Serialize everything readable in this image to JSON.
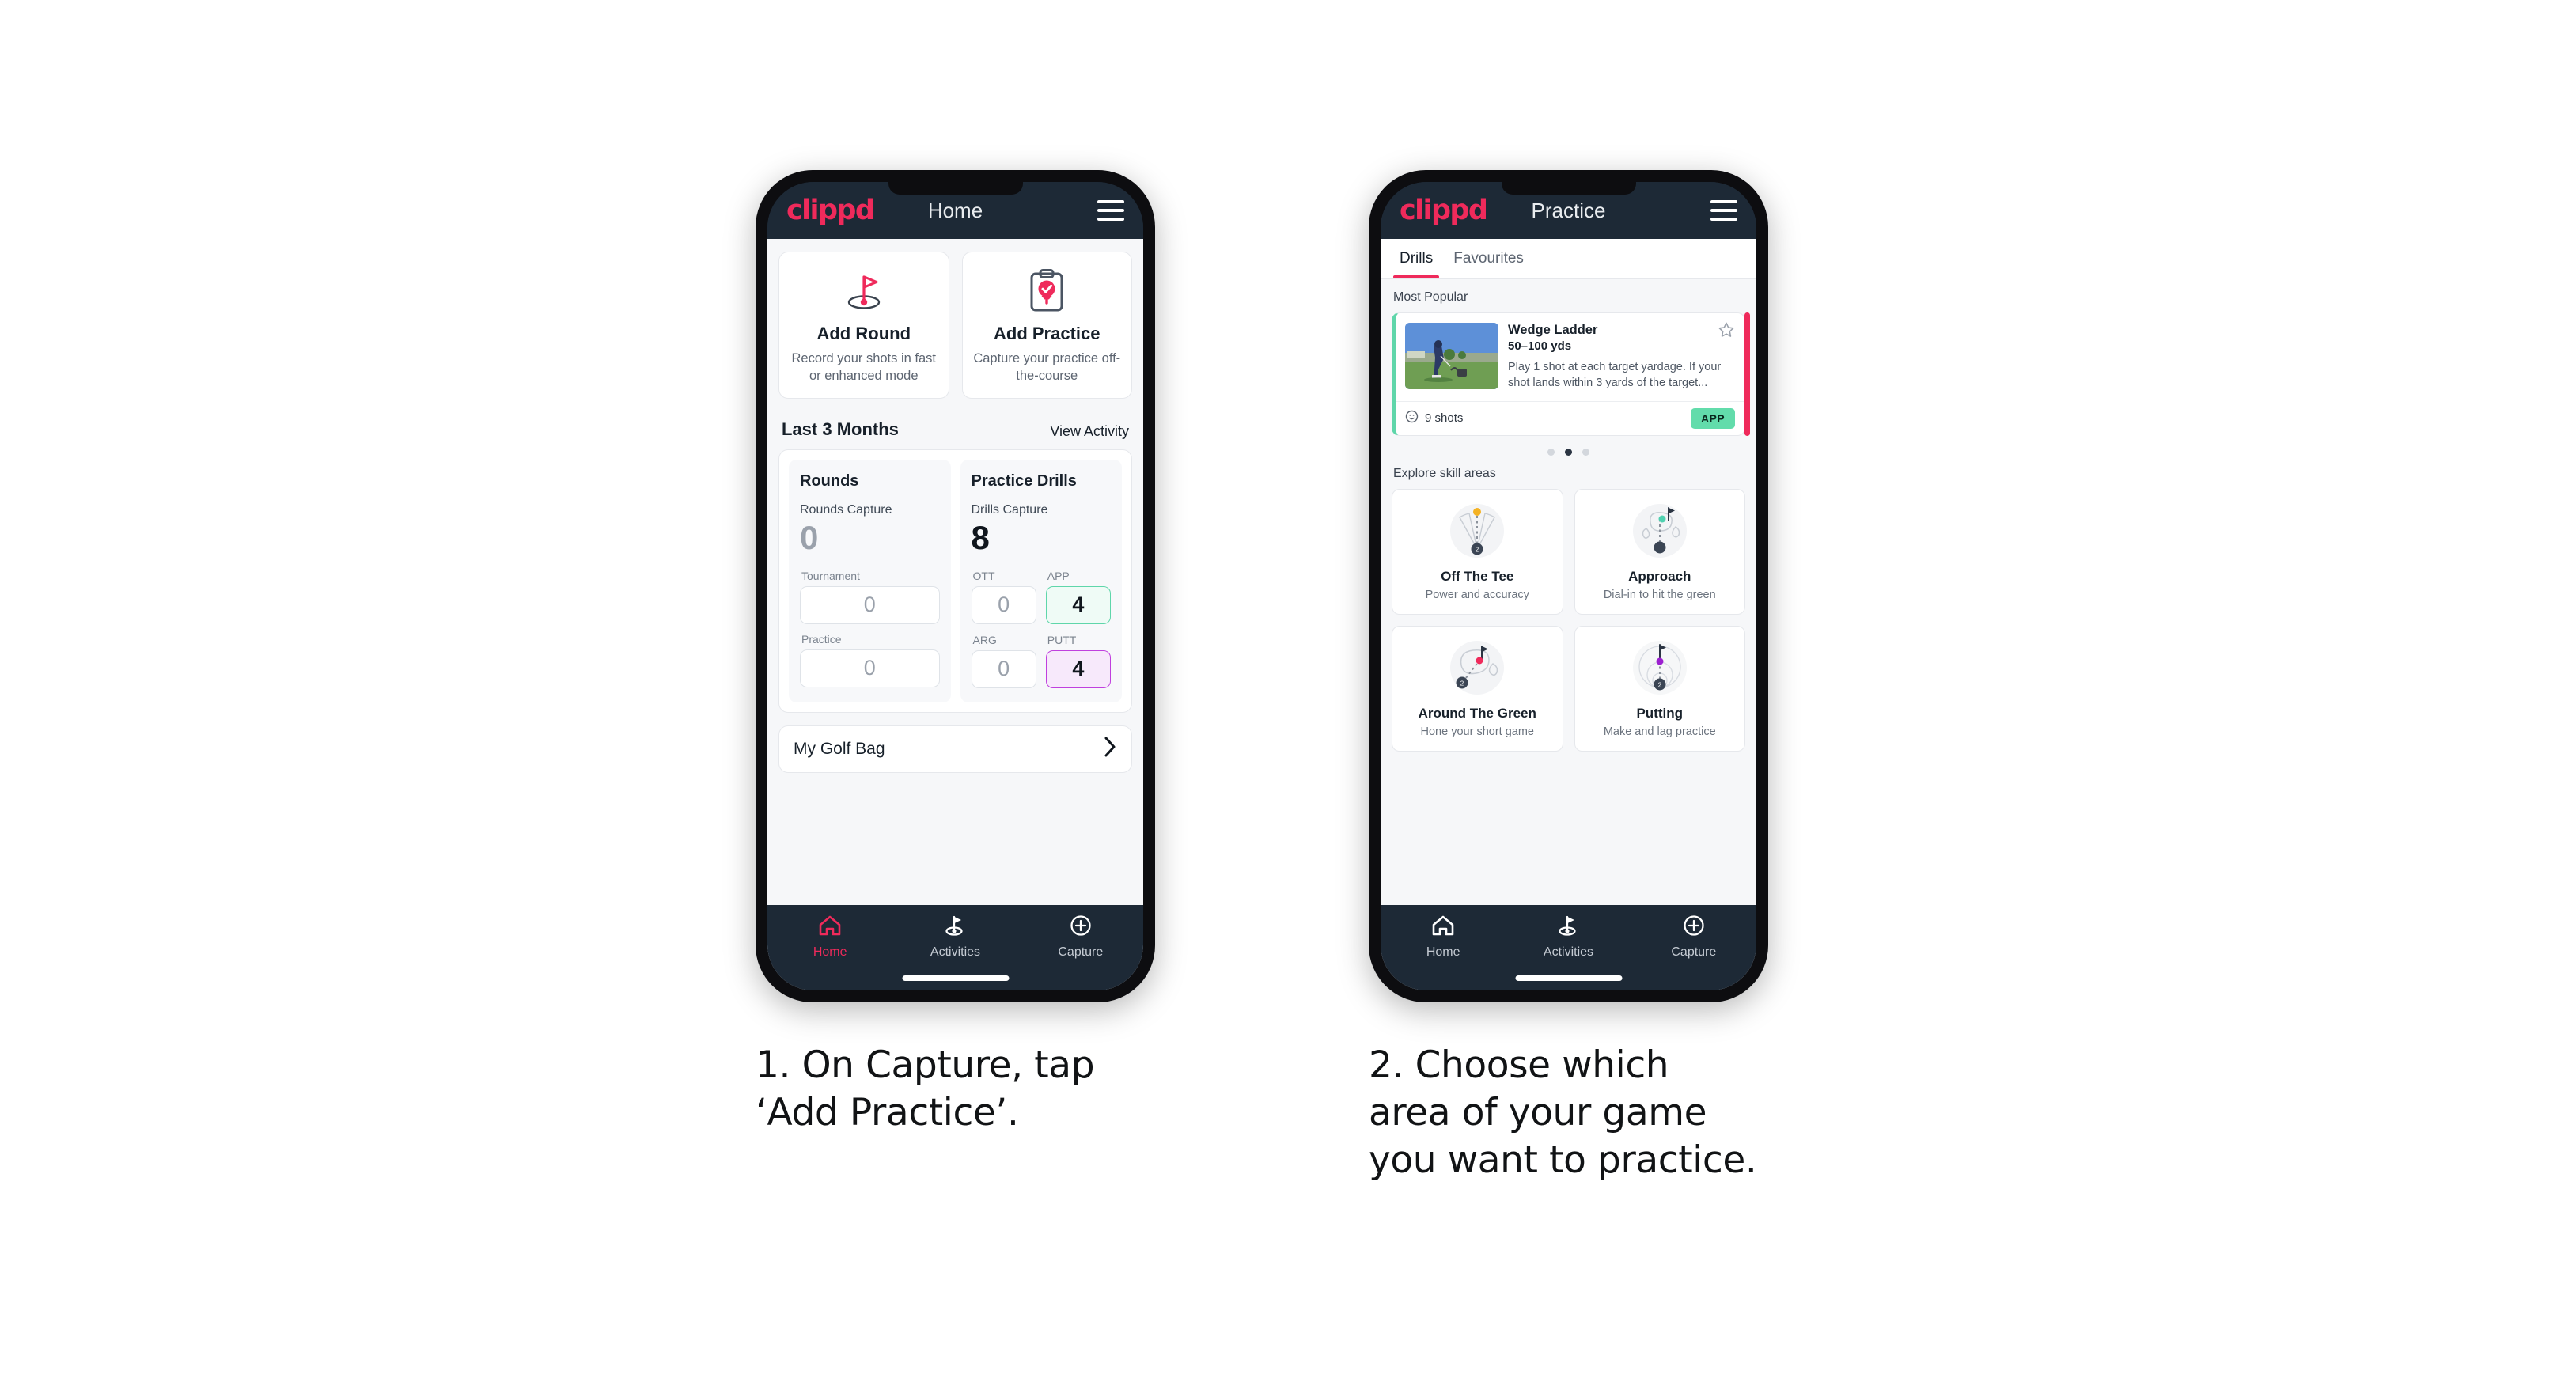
{
  "phone1": {
    "appbar": {
      "logo": "clippd",
      "title": "Home",
      "menu_icon": "hamburger-menu-icon"
    },
    "tiles": [
      {
        "icon": "golf-flag-icon",
        "title": "Add Round",
        "sub": "Record your shots in fast or enhanced mode"
      },
      {
        "icon": "clipboard-check-icon",
        "title": "Add Practice",
        "sub": "Capture your practice off-the-course"
      }
    ],
    "section": {
      "title": "Last 3 Months",
      "link": "View Activity"
    },
    "rounds": {
      "title": "Rounds",
      "capture_label": "Rounds Capture",
      "capture_value": "0",
      "fields": [
        {
          "label": "Tournament",
          "value": "0"
        },
        {
          "label": "Practice",
          "value": "0"
        }
      ]
    },
    "drills": {
      "title": "Practice Drills",
      "capture_label": "Drills Capture",
      "capture_value": "8",
      "fields": [
        {
          "label": "OTT",
          "value": "0",
          "style": "plain"
        },
        {
          "label": "APP",
          "value": "4",
          "style": "green"
        },
        {
          "label": "ARG",
          "value": "0",
          "style": "plain"
        },
        {
          "label": "PUTT",
          "value": "4",
          "style": "purple"
        }
      ]
    },
    "golf_bag": {
      "label": "My Golf Bag",
      "chevron": "chevron-right-icon"
    },
    "nav": [
      {
        "icon": "home-icon",
        "label": "Home",
        "active": true
      },
      {
        "icon": "golf-flag-icon",
        "label": "Activities",
        "active": false
      },
      {
        "icon": "plus-circle-icon",
        "label": "Capture",
        "active": false
      }
    ]
  },
  "phone2": {
    "appbar": {
      "logo": "clippd",
      "title": "Practice",
      "menu_icon": "hamburger-menu-icon"
    },
    "tabs": [
      {
        "label": "Drills",
        "active": true
      },
      {
        "label": "Favourites",
        "active": false
      }
    ],
    "most_popular_label": "Most Popular",
    "drill": {
      "thumbnail": "golf-player-photo",
      "name": "Wedge Ladder",
      "yardage": "50–100 yds",
      "description": "Play 1 shot at each target yardage. If your shot lands within 3 yards of the target...",
      "star_icon": "star-outline-icon",
      "shots_icon": "clock-icon",
      "shots": "9 shots",
      "badge": "APP",
      "accent": "#5fd6aa"
    },
    "carousel_dots": {
      "count": 3,
      "active_index": 1
    },
    "explore_label": "Explore skill areas",
    "skills": [
      {
        "icon": "off-the-tee-icon",
        "title": "Off The Tee",
        "sub": "Power and accuracy",
        "dot": "#f4b223"
      },
      {
        "icon": "approach-icon",
        "title": "Approach",
        "sub": "Dial-in to hit the green",
        "dot": "#4fd1b0"
      },
      {
        "icon": "around-the-green-icon",
        "title": "Around The Green",
        "sub": "Hone your short game",
        "dot": "#ef2a5b"
      },
      {
        "icon": "putting-icon",
        "title": "Putting",
        "sub": "Make and lag practice",
        "dot": "#9c1fd0"
      }
    ],
    "nav": [
      {
        "icon": "home-icon",
        "label": "Home",
        "active": false
      },
      {
        "icon": "golf-flag-icon",
        "label": "Activities",
        "active": false
      },
      {
        "icon": "plus-circle-icon",
        "label": "Capture",
        "active": false
      }
    ]
  },
  "captions": {
    "step1": "1. On Capture, tap\n‘Add Practice’.",
    "step2": "2. Choose which\narea of your game\nyou want to practice."
  },
  "colors": {
    "brand_pink": "#ef2a5b",
    "header_dark": "#1d2936",
    "green_accent": "#5fd6aa",
    "purple_accent": "#c040de"
  }
}
